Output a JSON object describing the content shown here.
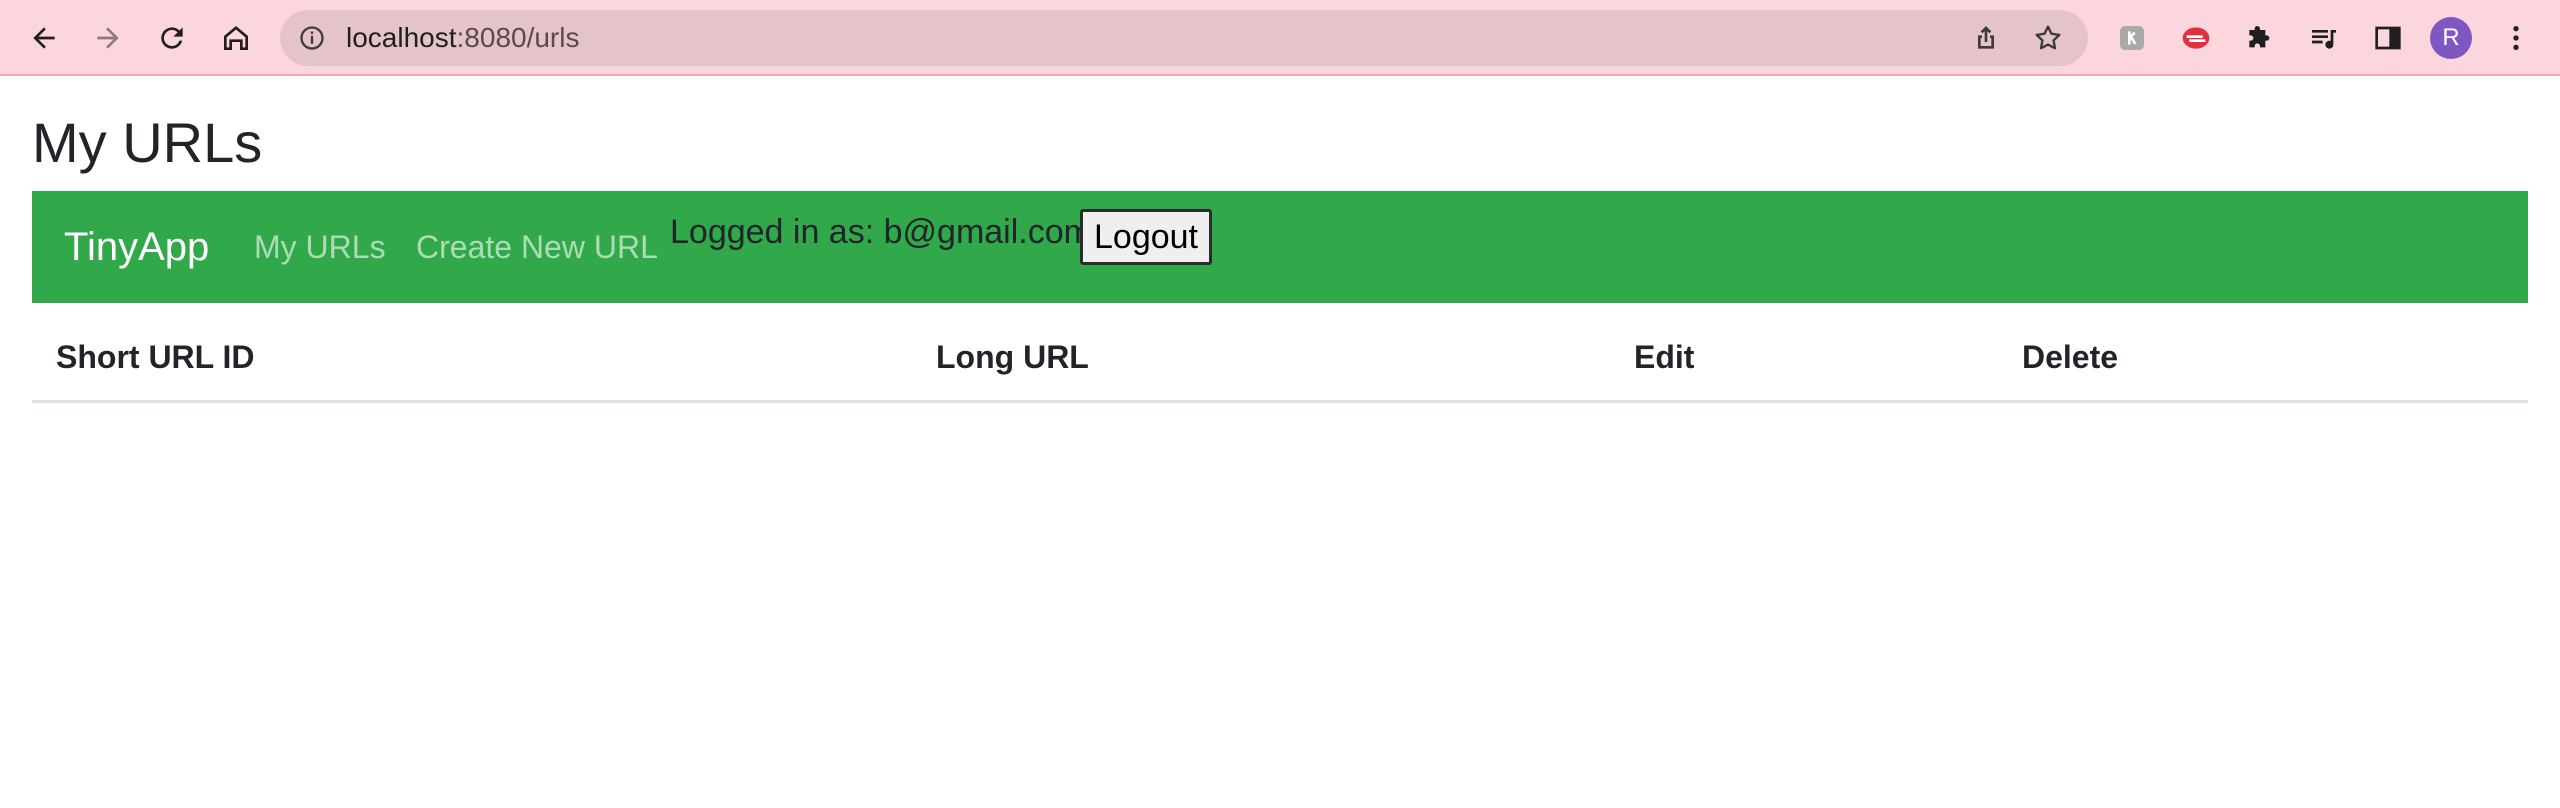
{
  "browser": {
    "url_host": "localhost",
    "url_path": ":8080/urls",
    "avatar_letter": "R",
    "icons": [
      "back-icon",
      "forward-icon",
      "reload-icon",
      "home-icon",
      "site-info-icon",
      "share-icon",
      "bookmark-star-icon",
      "extension-icon",
      "extension-icon",
      "puzzle-icon",
      "media-icon",
      "side-panel-icon",
      "menu-icon"
    ]
  },
  "page": {
    "title": "My URLs"
  },
  "navbar": {
    "brand": "TinyApp",
    "links": [
      "My URLs",
      "Create New URL"
    ],
    "logged_in_text": "Logged in as: b@gmail.com!",
    "logout_label": "Logout"
  },
  "table": {
    "headers": [
      "Short URL ID",
      "Long URL",
      "Edit",
      "Delete"
    ],
    "rows": []
  },
  "colors": {
    "navbar": "#31a84a",
    "chrome": "#fbd6dd",
    "avatar": "#7e57c2"
  }
}
